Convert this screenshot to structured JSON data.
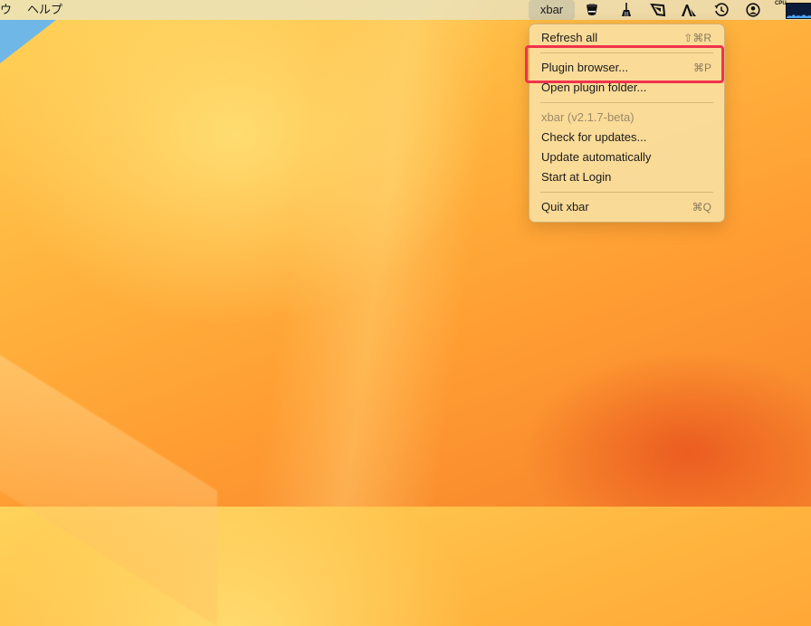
{
  "menubar": {
    "left_fragment": "ウ",
    "help_menu": "ヘルプ",
    "xbar_label": "xbar",
    "icons": [
      "top-hat-icon",
      "broom-icon",
      "window-flag-icon",
      "text-a-icon",
      "time-machine-icon",
      "user-circle-icon"
    ],
    "cpu_label": "CPU"
  },
  "menu": {
    "refresh_all": {
      "label": "Refresh all",
      "shortcut": "⇧⌘R"
    },
    "plugin_browser": {
      "label": "Plugin browser...",
      "shortcut": "⌘P"
    },
    "open_plugin_folder": {
      "label": "Open plugin folder..."
    },
    "version": {
      "label": "xbar (v2.1.7-beta)"
    },
    "check_updates": {
      "label": "Check for updates..."
    },
    "update_automatically": {
      "label": "Update automatically"
    },
    "start_at_login": {
      "label": "Start at Login"
    },
    "quit": {
      "label": "Quit xbar",
      "shortcut": "⌘Q"
    }
  },
  "colors": {
    "highlight_border": "#f0334b",
    "menu_background": "#fadea0",
    "wallpaper": "#ffa83a"
  }
}
